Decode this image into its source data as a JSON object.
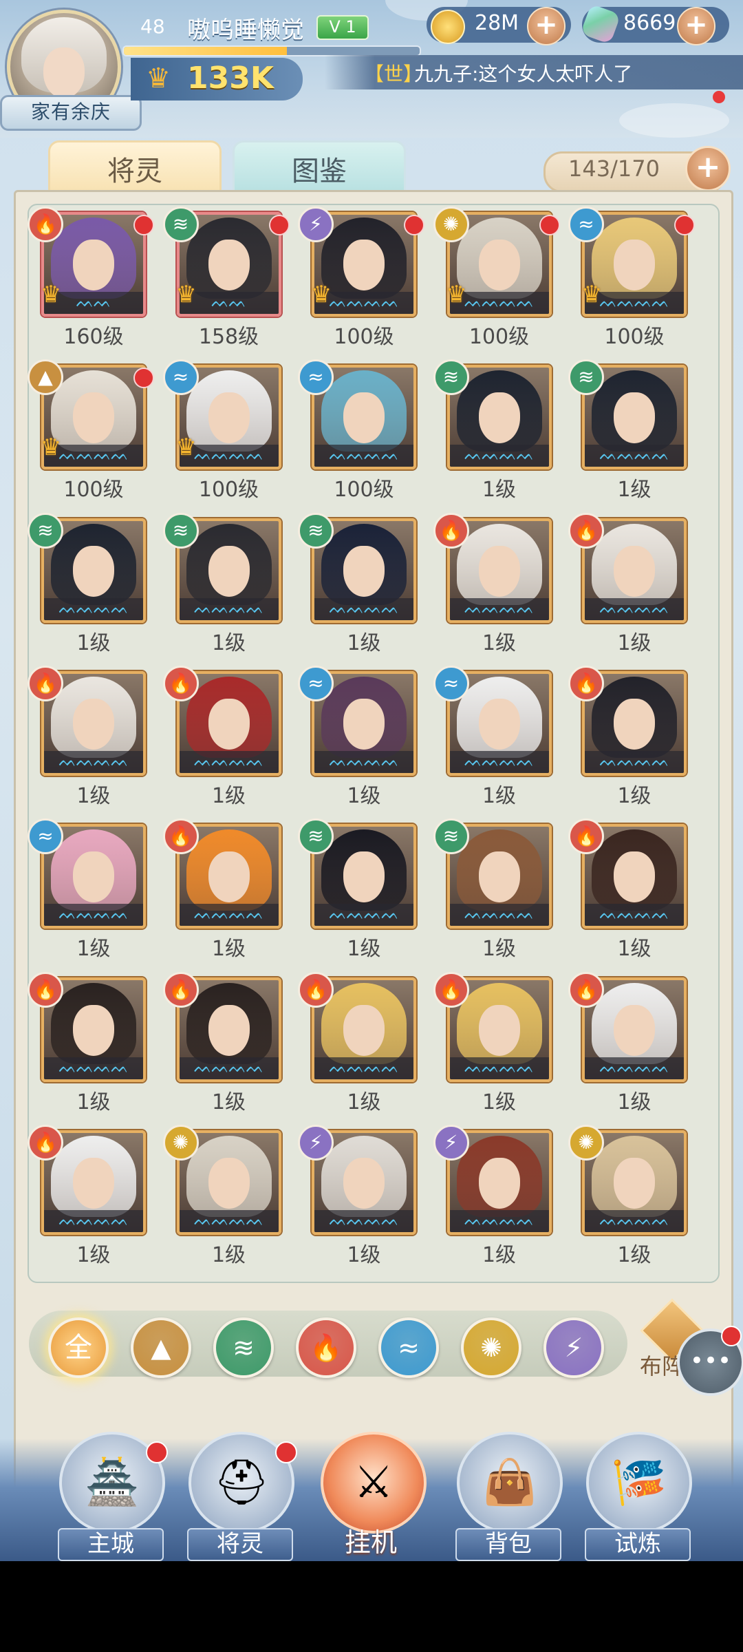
{
  "header": {
    "level": "48",
    "player_name": "嗷呜睡懒觉",
    "vip": "V 1",
    "exp_fraction": 0.55,
    "power": "133K",
    "family_tag": "家有余庆",
    "gold": "28M",
    "gems": "8669",
    "chat_channel": "【世】",
    "chat_message": "九九子:这个女人太吓人了"
  },
  "tabs": {
    "spirits": "将灵",
    "codex": "图鉴",
    "active": "spirits"
  },
  "capacity": "143/170",
  "elements": {
    "fire": {
      "glyph": "🔥",
      "color": "#d9574a"
    },
    "wind": {
      "glyph": "≋",
      "color": "#3e9a6a"
    },
    "thunder": {
      "glyph": "⚡",
      "color": "#8a72c2"
    },
    "light": {
      "glyph": "✺",
      "color": "#d6a830"
    },
    "water": {
      "glyph": "≈",
      "color": "#3e9ad0"
    },
    "earth": {
      "glyph": "▲",
      "color": "#c89040"
    }
  },
  "heroes": [
    {
      "element": "fire",
      "level": "160级",
      "stars": "ᨓᨓ",
      "red_dot": true,
      "rank": true,
      "selected": true,
      "hair": "#7a5aa8"
    },
    {
      "element": "wind",
      "level": "158级",
      "stars": "ᨓᨓ",
      "red_dot": true,
      "rank": true,
      "selected": true,
      "hair": "#2a2a30"
    },
    {
      "element": "thunder",
      "level": "100级",
      "stars": "ᨓᨓᨓᨓ",
      "red_dot": true,
      "rank": true,
      "selected": false,
      "hair": "#22222a"
    },
    {
      "element": "light",
      "level": "100级",
      "stars": "ᨓᨓᨓᨓ",
      "red_dot": true,
      "rank": true,
      "selected": false,
      "hair": "#d8d2c6"
    },
    {
      "element": "water",
      "level": "100级",
      "stars": "ᨓᨓᨓᨓ",
      "red_dot": true,
      "rank": true,
      "selected": false,
      "hair": "#e8c878"
    },
    {
      "element": "earth",
      "level": "100级",
      "stars": "ᨓᨓᨓᨓ",
      "red_dot": true,
      "rank": true,
      "selected": false,
      "hair": "#e6e0d6"
    },
    {
      "element": "water",
      "level": "100级",
      "stars": "ᨓᨓᨓᨓ",
      "red_dot": false,
      "rank": true,
      "selected": false,
      "hair": "#eeeeee"
    },
    {
      "element": "water",
      "level": "100级",
      "stars": "ᨓᨓᨓᨓ",
      "red_dot": false,
      "rank": false,
      "selected": false,
      "hair": "#6ab0c8"
    },
    {
      "element": "wind",
      "level": "1级",
      "stars": "ᨓᨓᨓᨓ",
      "red_dot": false,
      "rank": false,
      "selected": false,
      "hair": "#1e2430"
    },
    {
      "element": "wind",
      "level": "1级",
      "stars": "ᨓᨓᨓᨓ",
      "red_dot": false,
      "rank": false,
      "selected": false,
      "hair": "#1e2430"
    },
    {
      "element": "wind",
      "level": "1级",
      "stars": "ᨓᨓᨓᨓ",
      "red_dot": false,
      "rank": false,
      "selected": false,
      "hair": "#1e2430"
    },
    {
      "element": "wind",
      "level": "1级",
      "stars": "ᨓᨓᨓᨓ",
      "red_dot": false,
      "rank": false,
      "selected": false,
      "hair": "#2a2a30"
    },
    {
      "element": "wind",
      "level": "1级",
      "stars": "ᨓᨓᨓᨓ",
      "red_dot": false,
      "rank": false,
      "selected": false,
      "hair": "#1a2238"
    },
    {
      "element": "fire",
      "level": "1级",
      "stars": "ᨓᨓᨓᨓ",
      "red_dot": false,
      "rank": false,
      "selected": false,
      "hair": "#eae6e0"
    },
    {
      "element": "fire",
      "level": "1级",
      "stars": "ᨓᨓᨓᨓ",
      "red_dot": false,
      "rank": false,
      "selected": false,
      "hair": "#eae6e0"
    },
    {
      "element": "fire",
      "level": "1级",
      "stars": "ᨓᨓᨓᨓ",
      "red_dot": false,
      "rank": false,
      "selected": false,
      "hair": "#eae6e0"
    },
    {
      "element": "fire",
      "level": "1级",
      "stars": "ᨓᨓᨓᨓ",
      "red_dot": false,
      "rank": false,
      "selected": false,
      "hair": "#a82a2a"
    },
    {
      "element": "water",
      "level": "1级",
      "stars": "ᨓᨓᨓᨓ",
      "red_dot": false,
      "rank": false,
      "selected": false,
      "hair": "#5a3a5a"
    },
    {
      "element": "water",
      "level": "1级",
      "stars": "ᨓᨓᨓᨓ",
      "red_dot": false,
      "rank": false,
      "selected": false,
      "hair": "#eeeeee"
    },
    {
      "element": "fire",
      "level": "1级",
      "stars": "ᨓᨓᨓᨓ",
      "red_dot": false,
      "rank": false,
      "selected": false,
      "hair": "#22222a"
    },
    {
      "element": "water",
      "level": "1级",
      "stars": "ᨓᨓᨓᨓ",
      "red_dot": false,
      "rank": false,
      "selected": false,
      "hair": "#e8a8c0"
    },
    {
      "element": "fire",
      "level": "1级",
      "stars": "ᨓᨓᨓᨓ",
      "red_dot": false,
      "rank": false,
      "selected": false,
      "hair": "#f08a2a"
    },
    {
      "element": "wind",
      "level": "1级",
      "stars": "ᨓᨓᨓᨓ",
      "red_dot": false,
      "rank": false,
      "selected": false,
      "hair": "#1a1a22"
    },
    {
      "element": "wind",
      "level": "1级",
      "stars": "ᨓᨓᨓᨓ",
      "red_dot": false,
      "rank": false,
      "selected": false,
      "hair": "#8a5a3a"
    },
    {
      "element": "fire",
      "level": "1级",
      "stars": "ᨓᨓᨓᨓ",
      "red_dot": false,
      "rank": false,
      "selected": false,
      "hair": "#3a2620"
    },
    {
      "element": "fire",
      "level": "1级",
      "stars": "ᨓᨓᨓᨓ",
      "red_dot": false,
      "rank": false,
      "selected": false,
      "hair": "#2a2220"
    },
    {
      "element": "fire",
      "level": "1级",
      "stars": "ᨓᨓᨓᨓ",
      "red_dot": false,
      "rank": false,
      "selected": false,
      "hair": "#2a2220"
    },
    {
      "element": "fire",
      "level": "1级",
      "stars": "ᨓᨓᨓᨓ",
      "red_dot": false,
      "rank": false,
      "selected": false,
      "hair": "#e6c060"
    },
    {
      "element": "fire",
      "level": "1级",
      "stars": "ᨓᨓᨓᨓ",
      "red_dot": false,
      "rank": false,
      "selected": false,
      "hair": "#e6c060"
    },
    {
      "element": "fire",
      "level": "1级",
      "stars": "ᨓᨓᨓᨓ",
      "red_dot": false,
      "rank": false,
      "selected": false,
      "hair": "#eeeeee"
    },
    {
      "element": "fire",
      "level": "1级",
      "stars": "ᨓᨓᨓᨓ",
      "red_dot": false,
      "rank": false,
      "selected": false,
      "hair": "#eeeeee"
    },
    {
      "element": "light",
      "level": "1级",
      "stars": "ᨓᨓᨓᨓ",
      "red_dot": false,
      "rank": false,
      "selected": false,
      "hair": "#d8d2c6"
    },
    {
      "element": "thunder",
      "level": "1级",
      "stars": "ᨓᨓᨓᨓ",
      "red_dot": false,
      "rank": false,
      "selected": false,
      "hair": "#e0dcd6"
    },
    {
      "element": "thunder",
      "level": "1级",
      "stars": "ᨓᨓᨓᨓ",
      "red_dot": false,
      "rank": false,
      "selected": false,
      "hair": "#8a3a2a"
    },
    {
      "element": "light",
      "level": "1级",
      "stars": "ᨓᨓᨓᨓ",
      "red_dot": false,
      "rank": false,
      "selected": false,
      "hair": "#d8c29a"
    }
  ],
  "filters": {
    "all_label": "全",
    "order": [
      "earth",
      "wind",
      "fire",
      "water",
      "light",
      "thunder"
    ]
  },
  "formation_label": "布阵",
  "nav": {
    "city": "主城",
    "spirits": "将灵",
    "idle": "挂机",
    "bag": "背包",
    "trial": "试炼"
  }
}
